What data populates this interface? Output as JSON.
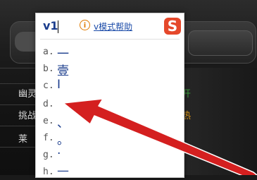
{
  "ime": {
    "composition": "v1",
    "help_icon": "info-icon",
    "help_link": "v模式帮助",
    "logo": "sogou-logo",
    "candidates": [
      {
        "key": "a.",
        "value": "一"
      },
      {
        "key": "b.",
        "value": "壹"
      },
      {
        "key": "c.",
        "value": "I"
      },
      {
        "key": "d.",
        "value": ""
      },
      {
        "key": "e.",
        "value": "、"
      },
      {
        "key": "f.",
        "value": "。"
      },
      {
        "key": "g.",
        "value": "·"
      },
      {
        "key": "h.",
        "value": "—"
      }
    ]
  },
  "background": {
    "rows": [
      {
        "left": "幽灵",
        "right": "开"
      },
      {
        "left": "挑战",
        "right": "热"
      },
      {
        "left": "莱",
        "right": ""
      }
    ]
  },
  "colors": {
    "arrow": "#d41f1f",
    "logo": "#e5482b",
    "candidate_text": "#1a3c8c",
    "help_link": "#1a4aa8",
    "row_right_green": "#3a9a3a",
    "row_right_orange": "#e09a1a"
  }
}
